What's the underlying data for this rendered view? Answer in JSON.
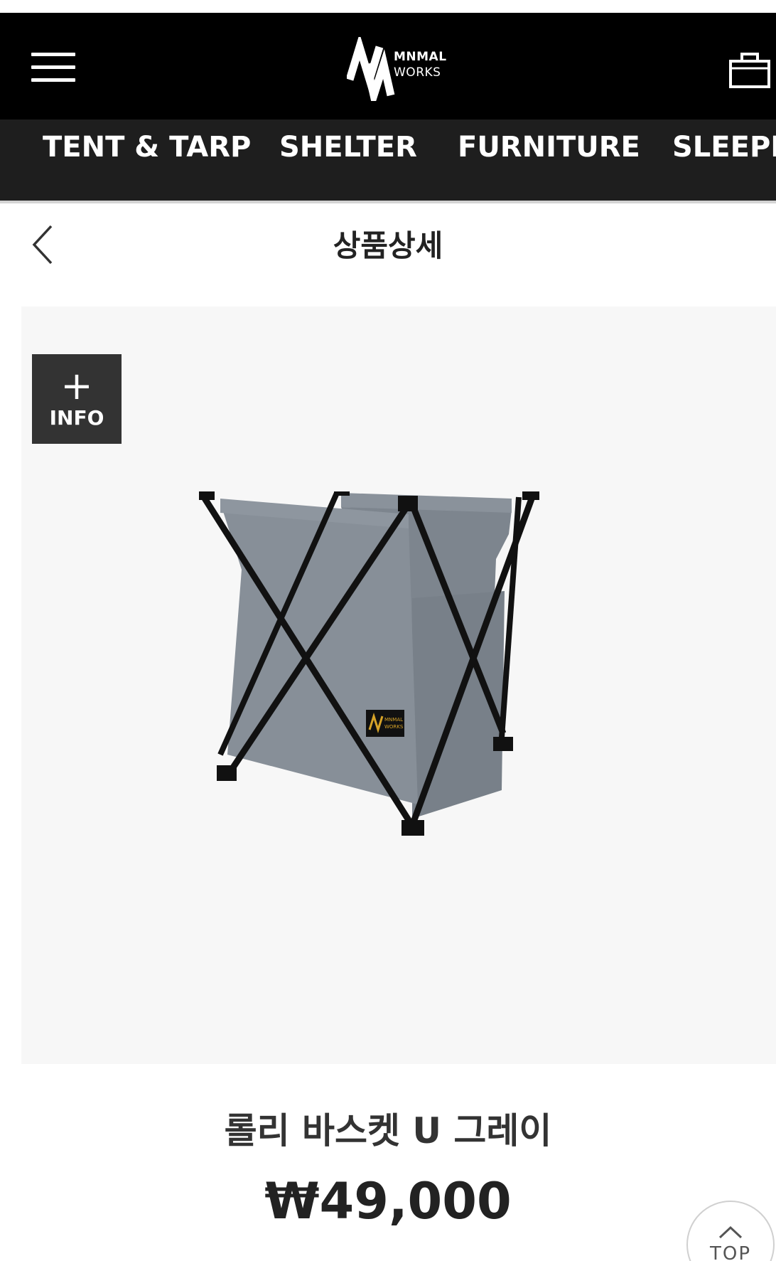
{
  "header": {
    "logo": {
      "line1": "MNMAL",
      "line2": "WORKS",
      "alt": "MNMAL WORKS"
    },
    "menu_icon": "hamburger-menu-icon",
    "cart_icon": "shopping-bag-icon"
  },
  "categories": [
    {
      "label": "TENT & TARP"
    },
    {
      "label": "SHELTER"
    },
    {
      "label": "FURNITURE"
    },
    {
      "label": "SLEEPIN"
    }
  ],
  "page": {
    "title": "상품상세",
    "back_icon": "chevron-left-icon"
  },
  "product": {
    "image_label": {
      "line1": "MNMAL",
      "line2": "WORKS"
    },
    "info_button": {
      "symbol": "+",
      "label": "INFO"
    },
    "name": "롤리 바스켓 U 그레이",
    "price": "₩49,000"
  },
  "scroll_top": {
    "label": "TOP",
    "icon": "chevron-up-icon"
  },
  "colors": {
    "header_bg": "#000000",
    "nav_bg": "#1e1e1e",
    "image_bg": "#f7f7f7",
    "basket_fabric": "#858d96",
    "frame": "#111111"
  }
}
